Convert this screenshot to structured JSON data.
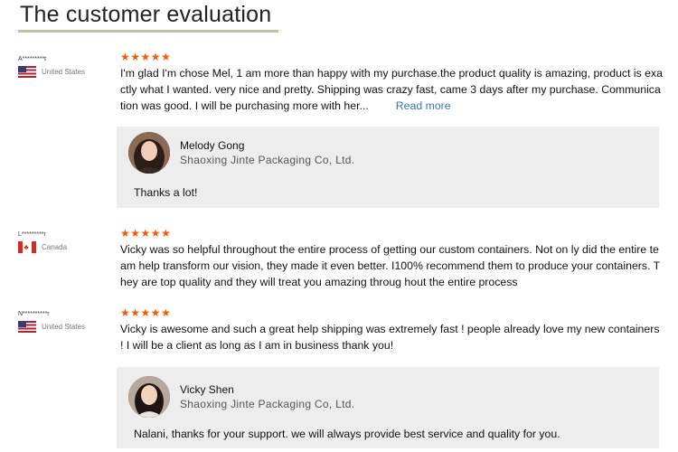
{
  "section": {
    "title": "The customer evaluation"
  },
  "reviews": [
    {
      "reviewer_name": "A*********t",
      "country": "United States",
      "flag": "us-flag",
      "rating": 5,
      "stars": "★★★★★",
      "text": "I'm glad I'm chose Mel, 1 am more than happy with my purchase.the product quality is amazing,   product is exactly what I wanted. very nice and pretty. Shipping was crazy fast, came 3 days after my purchase. Communication was good. I will be purchasing more with her...",
      "read_more": "Read more",
      "reply": {
        "name": "Melody Gong",
        "company": "Shaoxing Jinte Packaging Co, Ltd.",
        "text": "Thanks a lot!"
      }
    },
    {
      "reviewer_name": "L*********r",
      "country": "Canada",
      "flag": "canada-flag",
      "rating": 5,
      "stars": "★★★★★",
      "text": "Vicky was so helpful throughout the entire process of getting our custom containers. Not on ly did the entire team help transform our vision, they made it even better. I100% recommend them to produce your containers. They are top quality and they will treat you amazing throug hout the entire process"
    },
    {
      "reviewer_name": "N**********r",
      "country": "United States",
      "flag": "us-flag",
      "rating": 5,
      "stars": "★★★★★",
      "text": "Vicky is awesome and such a great help shipping was extremely fast ! people already love my new containers ! I will be a client as long as I am in business thank you!",
      "reply": {
        "name": "Vicky Shen",
        "company": "Shaoxing Jinte Packaging Co, Ltd.",
        "text": "Nalani, thanks for your support. we will always provide best service and quality for you."
      }
    }
  ]
}
